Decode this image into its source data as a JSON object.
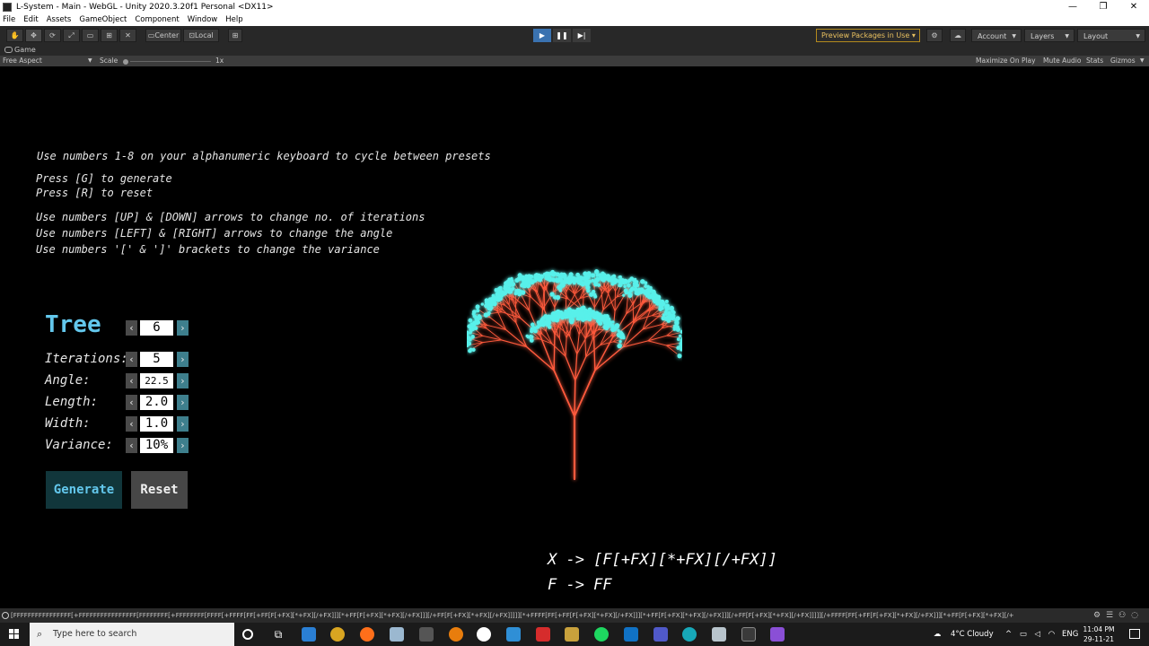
{
  "window": {
    "title": "L-System - Main - WebGL - Unity 2020.3.20f1 Personal <DX11>",
    "controls": [
      "—",
      "❐",
      "✕"
    ]
  },
  "menu": [
    "File",
    "Edit",
    "Assets",
    "GameObject",
    "Component",
    "Window",
    "Help"
  ],
  "toolbar": {
    "pivot": "Center",
    "space": "Local",
    "preview_packages": "Preview Packages in Use",
    "account": "Account",
    "layers": "Layers",
    "layout": "Layout"
  },
  "game_tab": {
    "label": "Game",
    "aspect": "Free Aspect",
    "scale_label": "Scale",
    "scale_value": "1x",
    "maximize": "Maximize On Play",
    "mute": "Mute Audio",
    "stats": "Stats",
    "gizmos": "Gizmos"
  },
  "instructions": {
    "presets": "Use numbers 1-8 on your alphanumeric keyboard to cycle between presets",
    "generate": "Press [G] to generate",
    "reset": "Press [R] to reset",
    "iterations": "Use numbers [UP] & [DOWN] arrows to change no. of iterations",
    "angle": "Use numbers [LEFT] & [RIGHT] arrows to change the angle",
    "variance": "Use numbers '[' & ']' brackets to change the variance"
  },
  "panel": {
    "preset_name": "Tree",
    "preset_number": "6",
    "params": [
      {
        "label": "Iterations:",
        "value": "5"
      },
      {
        "label": "Angle:",
        "value": "22.5"
      },
      {
        "label": "Length:",
        "value": "2.0"
      },
      {
        "label": "Width:",
        "value": "1.0"
      },
      {
        "label": "Variance:",
        "value": "10%"
      }
    ],
    "generate_label": "Generate",
    "reset_label": "Reset"
  },
  "rules": {
    "rule_x": "X -> [F[+FX][*+FX][/+FX]]",
    "rule_f": "F -> FF"
  },
  "status_bar": {
    "text": "[FFFFFFFFFFFFFFFF[+FFFFFFFFFFFFFFFF[FFFFFFFF[+FFFFFFFF[FFFF[+FFFF[FF[+FF[F[+FX][*+FX][/+FX]]][*+FF[F[+FX][*+FX][/+FX]]][/+FF[F[+FX][*+FX][/+FX]]]]][*+FFFF[FF[+FF[F[+FX][*+FX][/+FX]]][*+FF[F[+FX][*+FX][/+FX]]][/+FF[F[+FX][*+FX][/+FX]]]]][/+FFFF[FF[+FF[F[+FX][*+FX][/+FX]]][*+FF[F[+FX][*+FX][/+"
  },
  "taskbar": {
    "search_placeholder": "Type here to search",
    "weather": "4°C  Cloudy",
    "language": "ENG",
    "time": "11:04 PM",
    "date": "29-11-21"
  },
  "colors": {
    "accent_cyan": "#63c7ec",
    "branch": "#ff5a3c",
    "leaf": "#58f0ea",
    "play_active": "#3a72b0"
  }
}
